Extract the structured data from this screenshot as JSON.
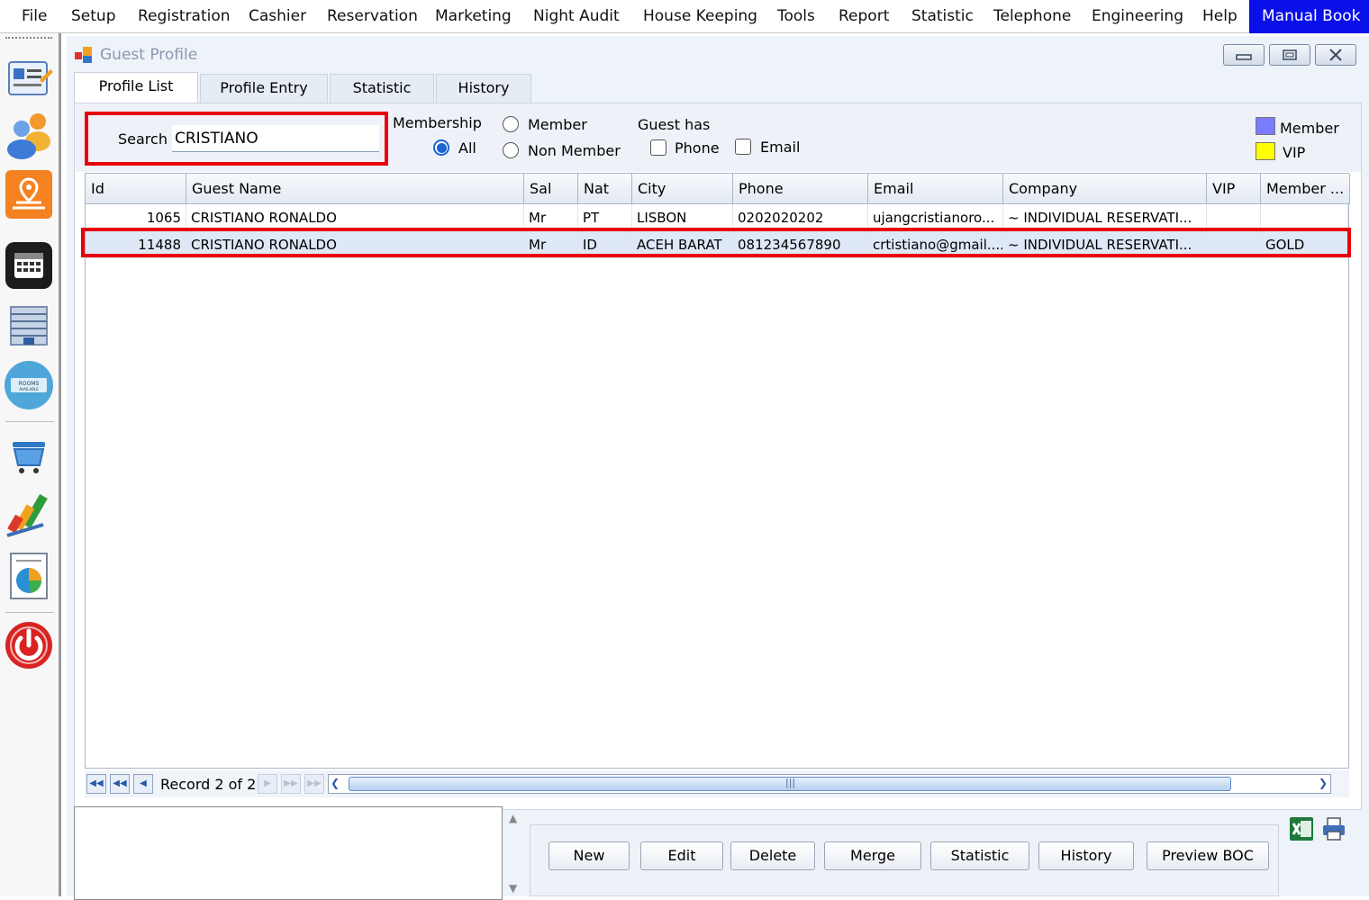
{
  "menu": [
    "File",
    "Setup",
    "Registration",
    "Cashier",
    "Reservation",
    "Marketing",
    "Night Audit",
    "House Keeping",
    "Tools",
    "Report",
    "Statistic",
    "Telephone",
    "Engineering",
    "Help"
  ],
  "menu_manual": "Manual Book",
  "window": {
    "title": "Guest Profile"
  },
  "tabs": [
    "Profile List",
    "Profile Entry",
    "Statistic",
    "History"
  ],
  "filter": {
    "search_label": "Search",
    "search_value": "CRISTIANO",
    "membership_label": "Membership",
    "opt_member": "Member",
    "opt_all": "All",
    "opt_non_member": "Non Member",
    "guest_has_label": "Guest has",
    "chk_phone": "Phone",
    "chk_email": "Email",
    "legend_member": "Member",
    "legend_vip": "VIP",
    "legend_member_color": "#7b7bff",
    "legend_vip_color": "#ffff00"
  },
  "grid": {
    "columns": [
      "Id",
      "Guest Name",
      "Sal",
      "Nat",
      "City",
      "Phone",
      "Email",
      "Company",
      "VIP",
      "Member ..."
    ],
    "rows": [
      [
        "1065",
        "CRISTIANO RONALDO",
        "Mr",
        "PT",
        "LISBON",
        "0202020202",
        "ujangcristianoro...",
        "~ INDIVIDUAL RESERVATI...",
        "",
        ""
      ],
      [
        "11488",
        "CRISTIANO RONALDO",
        "Mr",
        "ID",
        "ACEH BARAT",
        "081234567890",
        "crtistiano@gmail....",
        "~ INDIVIDUAL RESERVATI...",
        "",
        "GOLD"
      ]
    ]
  },
  "nav": {
    "record": "Record 2 of 2"
  },
  "buttons": [
    "New",
    "Edit",
    "Delete",
    "Merge",
    "Statistic",
    "History",
    "Preview BOC"
  ],
  "icons": [
    "guest-card-icon",
    "users-icon",
    "map-pin-icon",
    "calendar-icon",
    "building-icon",
    "rooms-available-icon",
    "cart-icon",
    "bar-chart-icon",
    "pie-report-icon",
    "power-icon",
    "excel-export-icon",
    "print-icon"
  ]
}
